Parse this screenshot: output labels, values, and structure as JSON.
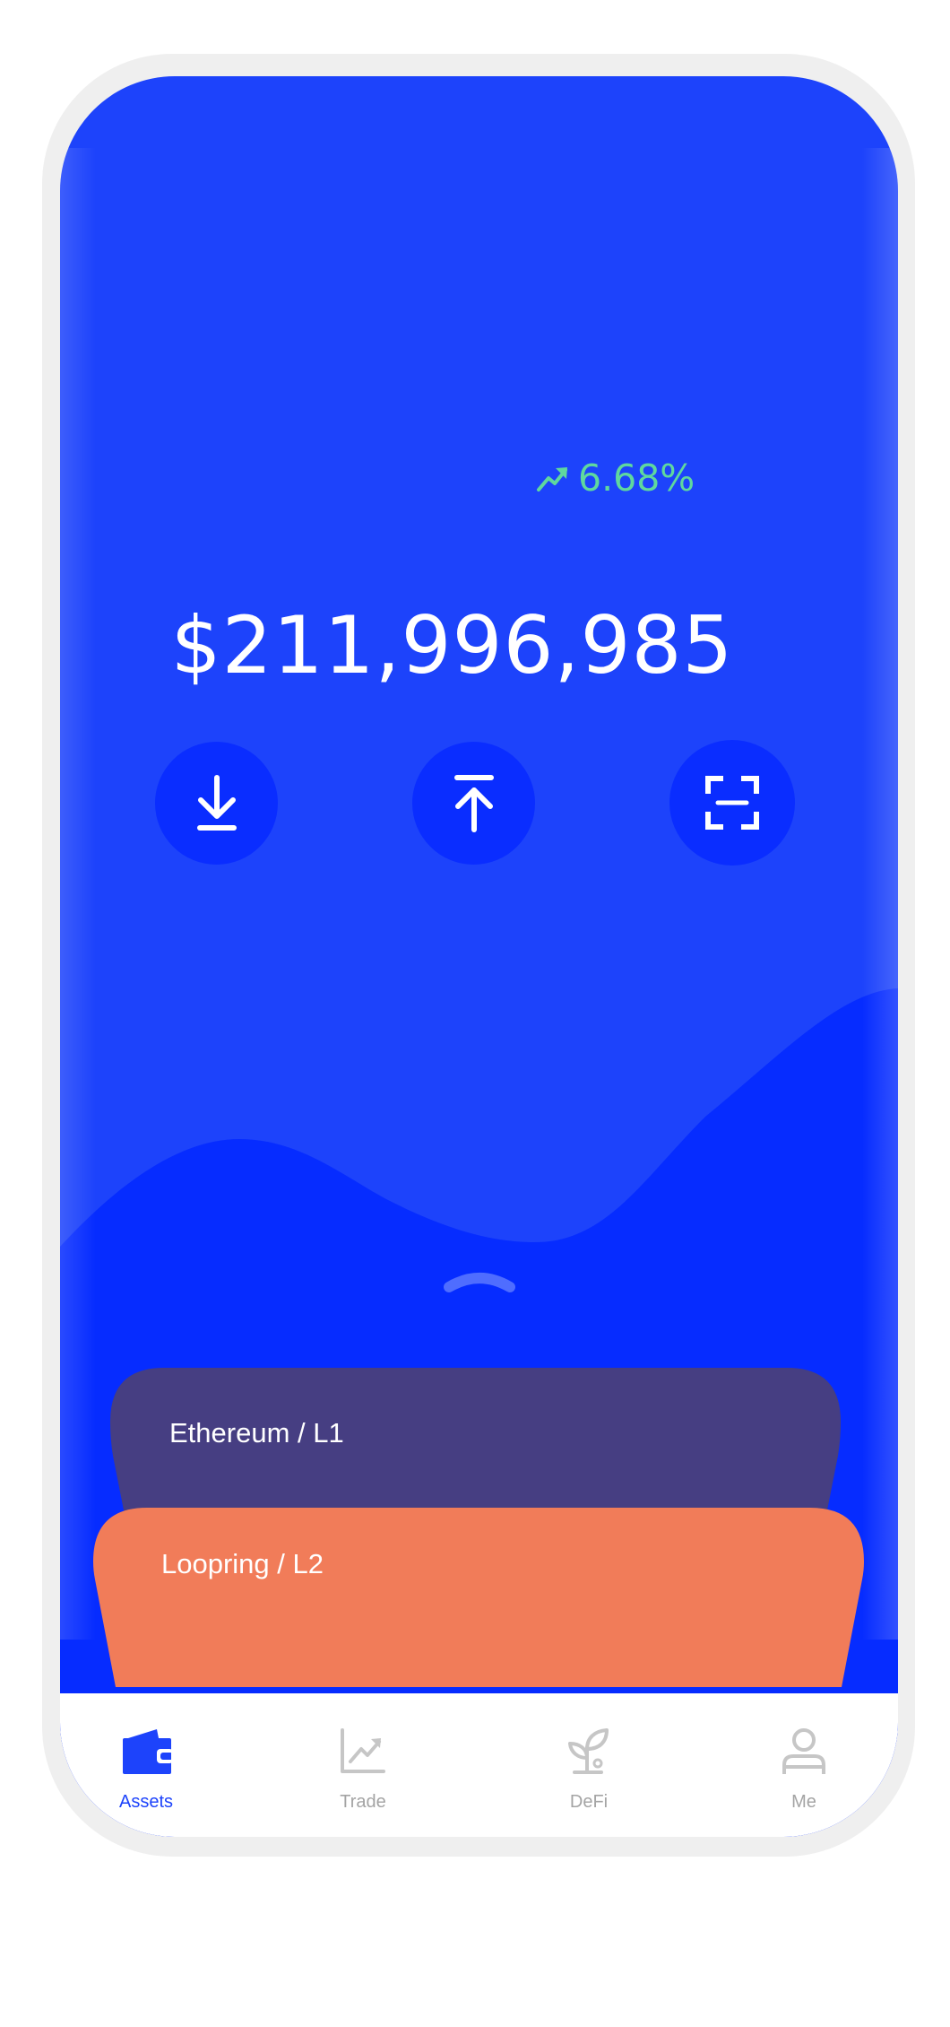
{
  "colors": {
    "screen_bg": "#1d43fb",
    "wave": "#062cff",
    "action_button": "#0a2dff",
    "positive": "#5fd89e",
    "card_ethereum": "#463e82",
    "card_loopring": "#f17c59",
    "tab_active": "#1d43fb",
    "tab_inactive": "#a4a4a4"
  },
  "portfolio": {
    "change_icon": "trending-up-icon",
    "change_percent": "6.68%",
    "currency_symbol": "$",
    "balance": "211,996,985"
  },
  "actions": [
    {
      "id": "receive",
      "icon": "download-icon"
    },
    {
      "id": "send",
      "icon": "upload-icon"
    },
    {
      "id": "scan",
      "icon": "scan-icon"
    }
  ],
  "expand_handle": {
    "icon": "chevron-up-icon"
  },
  "cards": [
    {
      "label": "Ethereum / L1"
    },
    {
      "label": "Loopring / L2"
    }
  ],
  "tabs": [
    {
      "label": "Assets",
      "icon": "wallet-icon",
      "active": true
    },
    {
      "label": "Trade",
      "icon": "chart-icon",
      "active": false
    },
    {
      "label": "DeFi",
      "icon": "sprout-icon",
      "active": false
    },
    {
      "label": "Me",
      "icon": "user-icon",
      "active": false
    }
  ]
}
